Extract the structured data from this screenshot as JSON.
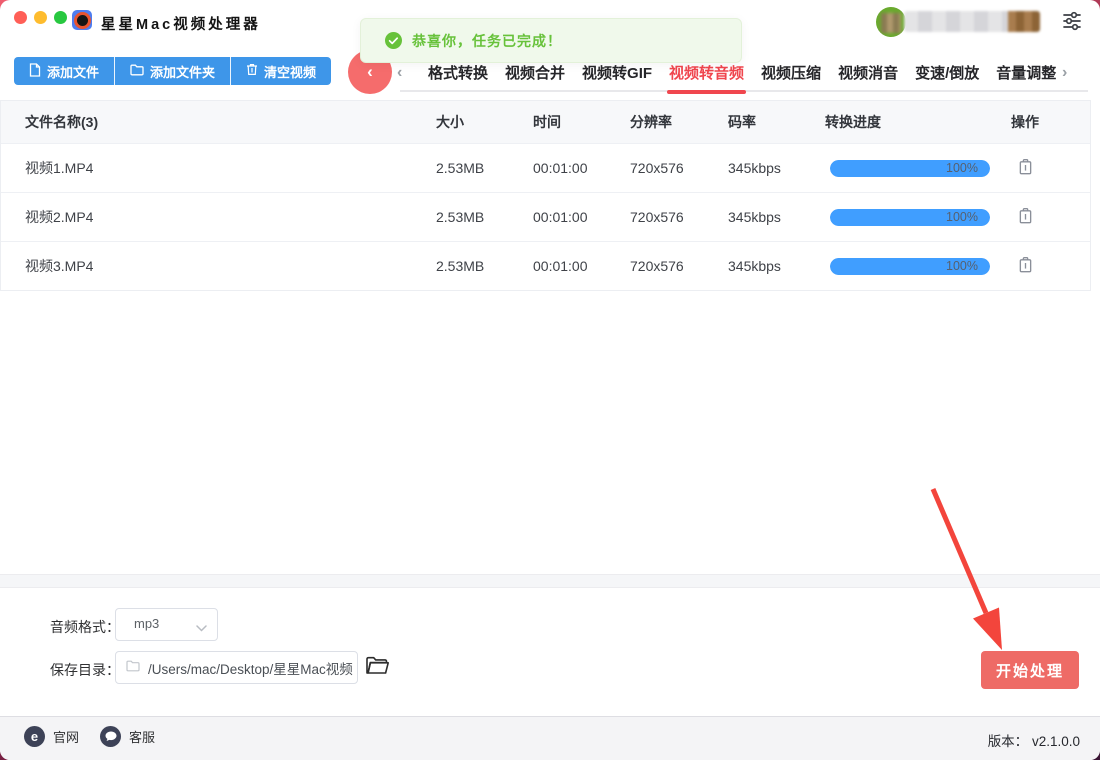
{
  "app": {
    "title": "星星Mac视频处理器",
    "version_label": "版本：",
    "version_value": "v2.1.0.0"
  },
  "toast": {
    "message": "恭喜你，任务已完成！"
  },
  "toolbar": {
    "add_file": "添加文件",
    "add_folder": "添加文件夹",
    "clear_videos": "清空视频"
  },
  "tabs": {
    "items": [
      {
        "label": "格式转换",
        "active": false
      },
      {
        "label": "视频合并",
        "active": false
      },
      {
        "label": "视频转GIF",
        "active": false
      },
      {
        "label": "视频转音频",
        "active": true
      },
      {
        "label": "视频压缩",
        "active": false
      },
      {
        "label": "视频消音",
        "active": false
      },
      {
        "label": "变速/倒放",
        "active": false
      },
      {
        "label": "音量调整",
        "active": false
      }
    ]
  },
  "icons": {
    "back_bubble": "‹",
    "chevron_left": "‹",
    "chevron_right": "›",
    "e_glyph": "e"
  },
  "table": {
    "columns": {
      "name": "文件名称(3)",
      "size": "大小",
      "time": "时间",
      "resolution": "分辨率",
      "bitrate": "码率",
      "progress": "转换进度",
      "action": "操作"
    },
    "rows": [
      {
        "name": "视频1.MP4",
        "size": "2.53MB",
        "time": "00:01:00",
        "resolution": "720x576",
        "bitrate": "345kbps",
        "progress": 100,
        "progress_text": "100%"
      },
      {
        "name": "视频2.MP4",
        "size": "2.53MB",
        "time": "00:01:00",
        "resolution": "720x576",
        "bitrate": "345kbps",
        "progress": 100,
        "progress_text": "100%"
      },
      {
        "name": "视频3.MP4",
        "size": "2.53MB",
        "time": "00:01:00",
        "resolution": "720x576",
        "bitrate": "345kbps",
        "progress": 100,
        "progress_text": "100%"
      }
    ]
  },
  "panel": {
    "audio_format_label": "音频格式：",
    "audio_format_value": "mp3",
    "save_dir_label": "保存目录：",
    "save_dir_value": "/Users/mac/Desktop/星星Mac视频",
    "start_button": "开始处理"
  },
  "footer": {
    "official_site": "官网",
    "support": "客服"
  },
  "colors": {
    "accent_blue": "#3e96e9",
    "progress_blue": "#409eff",
    "success_green": "#67c23a",
    "active_tab_red": "#f0464e",
    "start_button_red": "#ee6b66",
    "arrow_red": "#f3453c"
  }
}
